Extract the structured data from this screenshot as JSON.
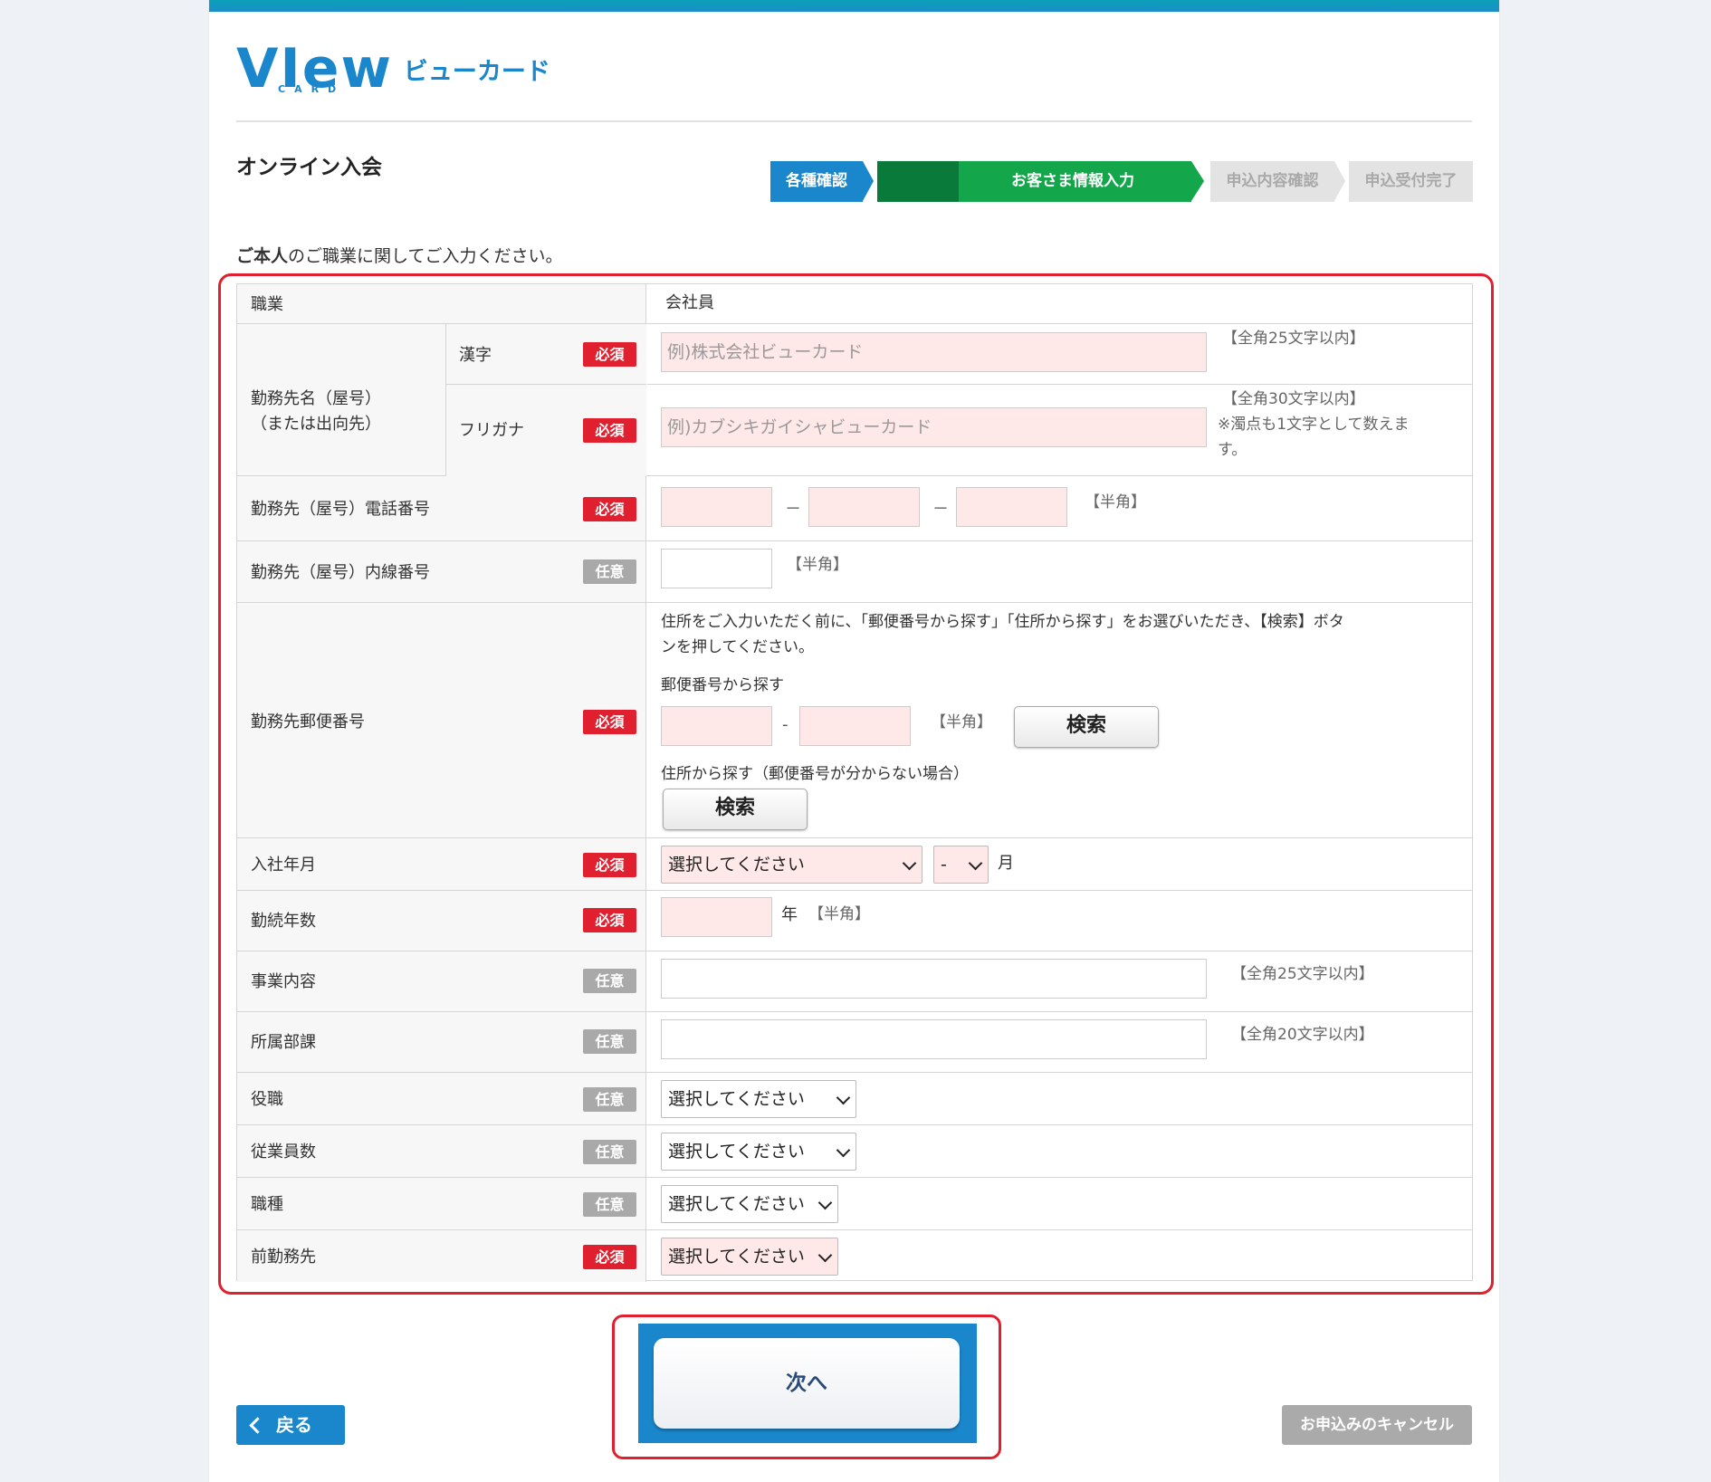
{
  "header": {
    "logo_word": "VIew",
    "logo_card": "CARD",
    "logo_kana": "ビューカード",
    "page_title": "オンライン入会",
    "steps": [
      "各種確認",
      "お客さま情報入力",
      "申込内容確認",
      "申込受付完了"
    ]
  },
  "instruction": {
    "bold": "ご本人",
    "rest": "のご職業に関してご入力ください。"
  },
  "badges": {
    "required": "必須",
    "optional": "任意"
  },
  "form": {
    "occupation": {
      "label": "職業",
      "value": "会社員"
    },
    "employer": {
      "label_line1": "勤務先名（屋号）",
      "label_line2": "（または出向先）",
      "kanji_label": "漢字",
      "kanji_placeholder": "例)株式会社ビューカード",
      "kanji_hint": "【全角25文字以内】",
      "kana_label": "フリガナ",
      "kana_placeholder": "例)カブシキガイシャビューカード",
      "kana_hint_1": "【全角30文字以内】",
      "kana_hint_2": "※濁点も1文字として数えま",
      "kana_hint_3": "す。"
    },
    "phone": {
      "label": "勤務先（屋号）電話番号",
      "sep": "－",
      "hint": "【半角】"
    },
    "extension": {
      "label": "勤務先（屋号）内線番号",
      "hint": "【半角】"
    },
    "postal": {
      "label": "勤務先郵便番号",
      "note_1": "住所をご入力いただく前に、「郵便番号から探す」「住所から探す」をお選びいただき、【検索】ボタ",
      "note_2": "ンを押してください。",
      "by_postal": "郵便番号から探す",
      "sep": "-",
      "hint": "【半角】",
      "search_label": "検索",
      "by_address": "住所から探す（郵便番号が分からない場合）"
    },
    "join_date": {
      "label": "入社年月",
      "year_select": "選択してください",
      "month_select": "-",
      "month_unit": "月"
    },
    "years": {
      "label": "勤続年数",
      "unit": "年",
      "hint": "【半角】"
    },
    "business": {
      "label": "事業内容",
      "hint": "【全角25文字以内】"
    },
    "department": {
      "label": "所属部課",
      "hint": "【全角20文字以内】"
    },
    "position": {
      "label": "役職",
      "select": "選択してください"
    },
    "employees": {
      "label": "従業員数",
      "select": "選択してください"
    },
    "job_type": {
      "label": "職種",
      "select": "選択してください"
    },
    "previous": {
      "label": "前勤務先",
      "select": "選択してください"
    }
  },
  "footer": {
    "next_label": "次へ",
    "back_label": "戻る",
    "cancel_label": "お申込みのキャンセル"
  },
  "colors": {
    "brand": "#1a86cc",
    "required": "#e0202e",
    "step_active": "#14a64b",
    "input_required_bg": "#ffe8e8"
  }
}
